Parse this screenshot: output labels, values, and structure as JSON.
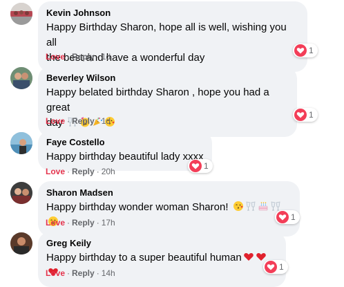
{
  "colors": {
    "bubble": "#f0f2f5",
    "love": "#e4334c",
    "meta": "#65676b"
  },
  "reaction_icon": "love-heart-icon",
  "comments": [
    {
      "author": "Kevin Johnson",
      "text_lines": [
        "Happy Birthday Sharon, hope all is well, wishing you all",
        "the best and have a wonderful day"
      ],
      "emojis": [],
      "love_label": "Love",
      "reply_label": "Reply",
      "time": "1d",
      "reaction_count": "1"
    },
    {
      "author": "Beverley Wilson",
      "text_lines": [
        "Happy belated birthday Sharon , hope you had a great",
        "day"
      ],
      "emojis": [
        "clinking-glasses",
        "partying-face",
        "party-popper",
        "kissing-face"
      ],
      "love_label": "Love",
      "reply_label": "Reply",
      "time": "1d",
      "reaction_count": "1"
    },
    {
      "author": "Faye Costello",
      "text_lines": [
        "Happy birthday beautiful lady xxxx"
      ],
      "emojis": [],
      "love_label": "Love",
      "reply_label": "Reply",
      "time": "20h",
      "reaction_count": "1"
    },
    {
      "author": "Sharon Madsen",
      "text_lines": [
        "Happy birthday wonder woman Sharon!"
      ],
      "emojis": [
        "kissing-face",
        "clinking-glasses",
        "birthday-cake",
        "clinking-glasses",
        "kissing-face"
      ],
      "love_label": "Love",
      "reply_label": "Reply",
      "time": "17h",
      "reaction_count": "1"
    },
    {
      "author": "Greg Keily",
      "text_lines": [
        "Happy birthday to a super beautiful human"
      ],
      "emojis": [
        "red-heart",
        "red-heart",
        "red-heart"
      ],
      "love_label": "Love",
      "reply_label": "Reply",
      "time": "14h",
      "reaction_count": "1"
    }
  ]
}
